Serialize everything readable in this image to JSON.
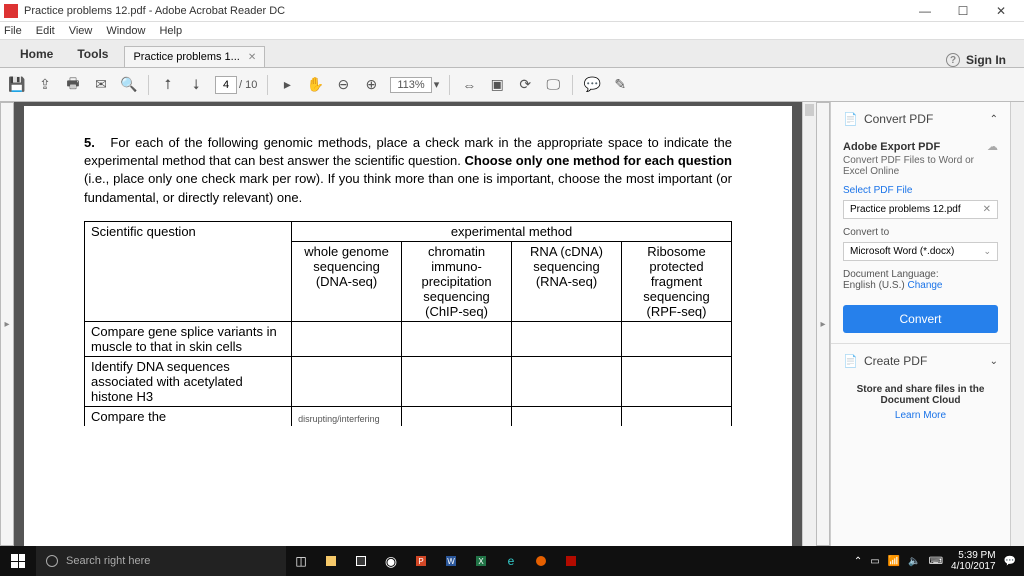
{
  "window": {
    "title": "Practice problems 12.pdf - Adobe Acrobat Reader DC",
    "min": "—",
    "max": "☐",
    "close": "✕"
  },
  "menu": {
    "file": "File",
    "edit": "Edit",
    "view": "View",
    "window": "Window",
    "help": "Help"
  },
  "tabs": {
    "home": "Home",
    "tools": "Tools",
    "doc": "Practice problems 1...",
    "x": "✕",
    "signin": "Sign In",
    "help": "?"
  },
  "toolbar": {
    "page_current": "4",
    "page_sep": "/ 10",
    "zoom": "113%",
    "zoom_caret": "▾"
  },
  "doc": {
    "num": "5.",
    "text_a": "For each of the following genomic methods, place a check mark in the appropriate space to indicate the experimental method that can best answer the scientific question.  ",
    "text_b": "Choose only one method for each question",
    "text_c": " (i.e., place only one check mark per row).  If you think more than one is important, choose the most important (or fundamental, or directly relevant) one.",
    "col_q": "Scientific question",
    "exp_hdr": "experimental method",
    "c1": "whole genome sequencing (DNA-seq)",
    "c2": "chromatin immuno-precipitation sequencing (ChIP-seq)",
    "c3": "RNA (cDNA) sequencing (RNA-seq)",
    "c4": "Ribosome protected fragment sequencing (RPF-seq)",
    "r1": "Compare gene splice variants in muscle to that in skin cells",
    "r2": "Identify DNA sequences associated with acetylated histone H3",
    "r3": "Compare the",
    "r3cut": "disrupting/interfering"
  },
  "right": {
    "convert_title": "Convert PDF",
    "caret_up": "⌃",
    "export_title": "Adobe Export PDF",
    "export_desc": "Convert PDF Files to Word or Excel Online",
    "select_label": "Select PDF File",
    "file": "Practice problems 12.pdf",
    "x": "✕",
    "convert_to": "Convert to",
    "fmt": "Microsoft Word (*.docx)",
    "caret": "⌄",
    "lang_label": "Document Language:",
    "lang": "English (U.S.)  ",
    "change": "Change",
    "convert_btn": "Convert",
    "create_title": "Create PDF",
    "caret_down": "⌄",
    "store": "Store and share files in the Document Cloud",
    "learn": "Learn More"
  },
  "taskbar": {
    "search": "Search right here",
    "time": "5:39 PM",
    "date": "4/10/2017",
    "tray_caret": "⌃"
  }
}
